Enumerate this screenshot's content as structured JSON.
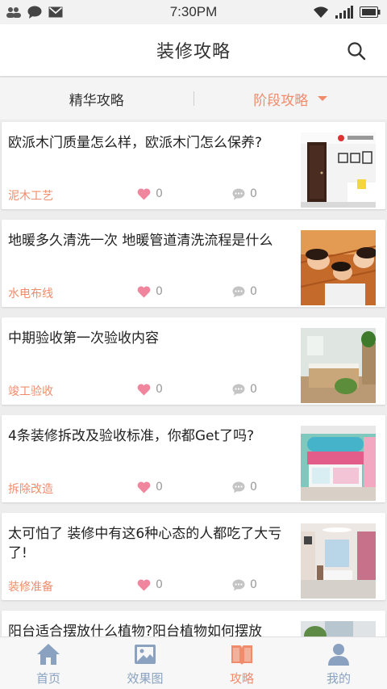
{
  "status_bar": {
    "time": "7:30PM",
    "icons": [
      "contacts-icon",
      "chat-bubble-icon",
      "mail-icon",
      "wifi-icon",
      "signal-icon",
      "battery-icon"
    ]
  },
  "header": {
    "title": "装修攻略",
    "search_icon": "search-icon"
  },
  "tabs": [
    {
      "label": "精华攻略",
      "active": false
    },
    {
      "label": "阶段攻略",
      "active": true,
      "icon": "dropdown-arrow-icon"
    }
  ],
  "articles": [
    {
      "title": "欧派木门质量怎么样，欧派木门怎么保养?",
      "tag": "泥木工艺",
      "likes": "0",
      "comments": "0",
      "thumb": "door-photo"
    },
    {
      "title": "地暖多久清洗一次 地暖管道清洗流程是什么",
      "tag": "水电布线",
      "likes": "0",
      "comments": "0",
      "thumb": "family-floor-photo"
    },
    {
      "title": "中期验收第一次验收内容",
      "tag": "竣工验收",
      "likes": "0",
      "comments": "0",
      "thumb": "bedroom-photo"
    },
    {
      "title": "4条装修拆改及验收标准，你都Get了吗?",
      "tag": "拆除改造",
      "likes": "0",
      "comments": "0",
      "thumb": "kids-room-photo"
    },
    {
      "title": "太可怕了 装修中有这6种心态的人都吃了大亏了!",
      "tag": "装修准备",
      "likes": "0",
      "comments": "0",
      "thumb": "living-room-photo"
    },
    {
      "title": "阳台适合摆放什么植物?阳台植物如何摆放",
      "tag": "",
      "likes": "",
      "comments": "",
      "thumb": "balcony-photo"
    }
  ],
  "bottom_nav": [
    {
      "label": "首页",
      "icon": "home-icon",
      "active": false
    },
    {
      "label": "效果图",
      "icon": "picture-icon",
      "active": false
    },
    {
      "label": "攻略",
      "icon": "book-icon",
      "active": true
    },
    {
      "label": "我的",
      "icon": "user-icon",
      "active": false
    }
  ],
  "colors": {
    "accent": "#f08c6b",
    "nav_inactive": "#8aa2c0",
    "background": "#ededed"
  }
}
